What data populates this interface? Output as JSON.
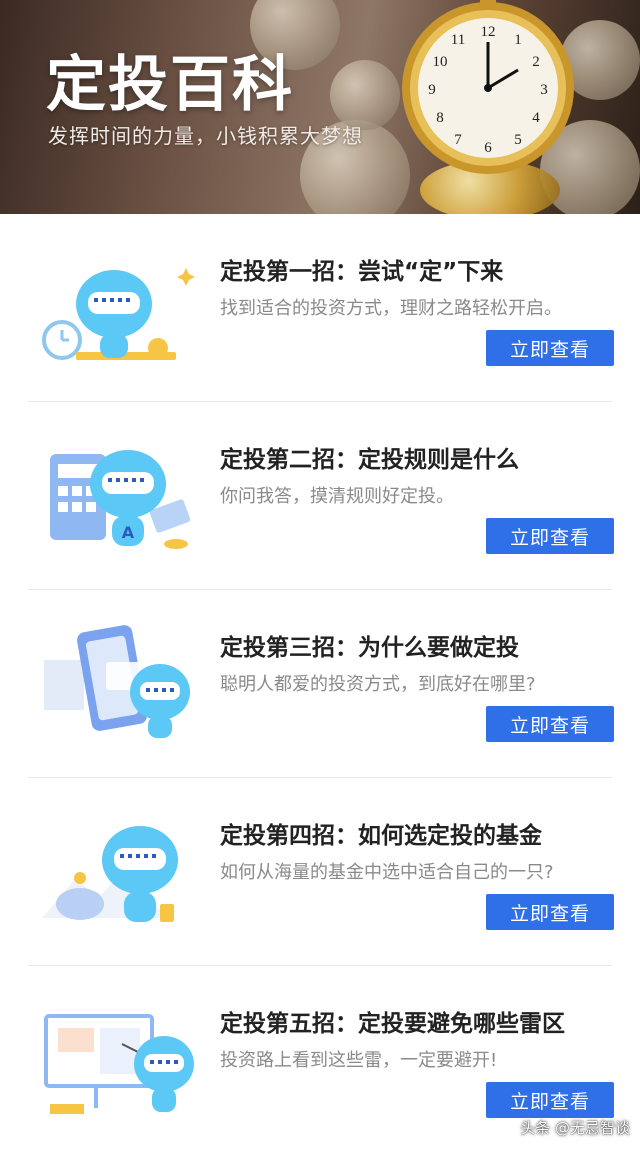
{
  "banner": {
    "title": "定投百科",
    "subtitle": "发挥时间的力量，小钱积累大梦想"
  },
  "cards": [
    {
      "title": "定投第一招：尝试“定”下来",
      "desc": "找到适合的投资方式，理财之路轻松开启。",
      "button": "立即查看",
      "illustration": "robot-with-alarm-clock"
    },
    {
      "title": "定投第二招：定投规则是什么",
      "desc": "你问我答，摸清规则好定投。",
      "button": "立即查看",
      "illustration": "robot-with-calculator"
    },
    {
      "title": "定投第三招：为什么要做定投",
      "desc": "聪明人都爱的投资方式，到底好在哪里?",
      "button": "立即查看",
      "illustration": "robot-with-phone"
    },
    {
      "title": "定投第四招：如何选定投的基金",
      "desc": "如何从海量的基金中选中适合自己的一只?",
      "button": "立即查看",
      "illustration": "robot-with-piggy-bank"
    },
    {
      "title": "定投第五招：定投要避免哪些雷区",
      "desc": "投资路上看到这些雷，一定要避开!",
      "button": "立即查看",
      "illustration": "robot-with-presentation-board"
    }
  ],
  "watermark": "头条 @无忌智谈",
  "colors": {
    "button": "#2f6fe8",
    "robot": "#5cc8f5",
    "title": "#222222",
    "desc": "#8a8a8a"
  }
}
